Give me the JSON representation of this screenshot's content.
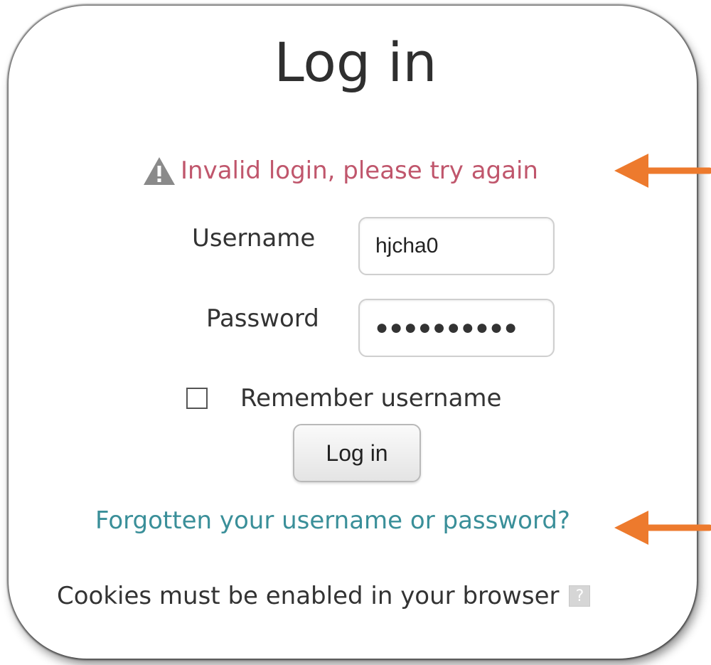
{
  "login_form": {
    "title": "Log in",
    "error_message": "Invalid login, please try again",
    "error_icon": "warning-triangle-icon",
    "username_label": "Username",
    "username_value": "hjcha0",
    "password_label": "Password",
    "password_mask": "●●●●●●●●●●",
    "remember_label": "Remember username",
    "remember_checked": false,
    "login_button": "Log in",
    "forgot_link": "Forgotten your username or password?",
    "cookies_notice": "Cookies must be enabled in your browser",
    "help_icon": "help-question-icon",
    "help_glyph": "?"
  },
  "annotations": {
    "arrow_icon": "left-arrow-icon",
    "arrow_color": "#ed7a2d"
  },
  "colors": {
    "error": "#c0566c",
    "link": "#3a8f99",
    "text": "#333333"
  }
}
